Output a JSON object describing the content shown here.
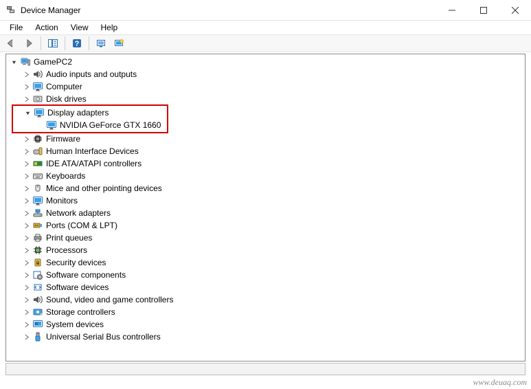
{
  "window": {
    "title": "Device Manager"
  },
  "menubar": {
    "items": [
      "File",
      "Action",
      "View",
      "Help"
    ]
  },
  "tree": {
    "root": "GamePC2",
    "nodes": [
      {
        "label": "Audio inputs and outputs",
        "icon": "speaker"
      },
      {
        "label": "Computer",
        "icon": "monitor"
      },
      {
        "label": "Disk drives",
        "icon": "disk"
      },
      {
        "label": "Display adapters",
        "icon": "monitor",
        "expanded": true,
        "children": [
          {
            "label": "NVIDIA GeForce GTX 1660",
            "icon": "monitor"
          }
        ]
      },
      {
        "label": "Firmware",
        "icon": "chip"
      },
      {
        "label": "Human Interface Devices",
        "icon": "hid"
      },
      {
        "label": "IDE ATA/ATAPI controllers",
        "icon": "ide"
      },
      {
        "label": "Keyboards",
        "icon": "keyboard"
      },
      {
        "label": "Mice and other pointing devices",
        "icon": "mouse"
      },
      {
        "label": "Monitors",
        "icon": "monitor"
      },
      {
        "label": "Network adapters",
        "icon": "network"
      },
      {
        "label": "Ports (COM & LPT)",
        "icon": "port"
      },
      {
        "label": "Print queues",
        "icon": "printer"
      },
      {
        "label": "Processors",
        "icon": "cpu"
      },
      {
        "label": "Security devices",
        "icon": "security"
      },
      {
        "label": "Software components",
        "icon": "softcomp"
      },
      {
        "label": "Software devices",
        "icon": "softdev"
      },
      {
        "label": "Sound, video and game controllers",
        "icon": "speaker"
      },
      {
        "label": "Storage controllers",
        "icon": "storage"
      },
      {
        "label": "System devices",
        "icon": "system"
      },
      {
        "label": "Universal Serial Bus controllers",
        "icon": "usb"
      }
    ]
  },
  "brand": "www.deuaq.com"
}
